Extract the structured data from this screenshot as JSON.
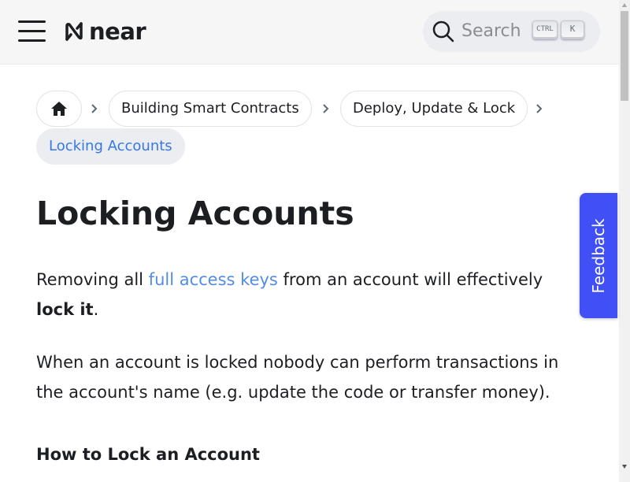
{
  "header": {
    "logo_text": "near",
    "search": {
      "placeholder": "Search",
      "shortcut_keys": [
        "CTRL",
        "K"
      ]
    }
  },
  "breadcrumb": {
    "items": [
      {
        "label": "Building Smart Contracts"
      },
      {
        "label": "Deploy, Update & Lock"
      }
    ],
    "active": "Locking Accounts"
  },
  "article": {
    "title": "Locking Accounts",
    "para1": {
      "before": "Removing all ",
      "link": "full access keys",
      "after": " from an account will effectively ",
      "bold": "lock it",
      "end": "."
    },
    "para2": "When an account is locked nobody can perform transactions in the account's name (e.g. update the code or transfer money).",
    "subheading": "How to Lock an Account"
  },
  "feedback_label": "Feedback",
  "colors": {
    "link": "#3578e5",
    "feedback": "#4050f5"
  },
  "icons": [
    "menu-icon",
    "near-logo-icon",
    "search-icon",
    "home-icon",
    "chevron-right-icon"
  ]
}
